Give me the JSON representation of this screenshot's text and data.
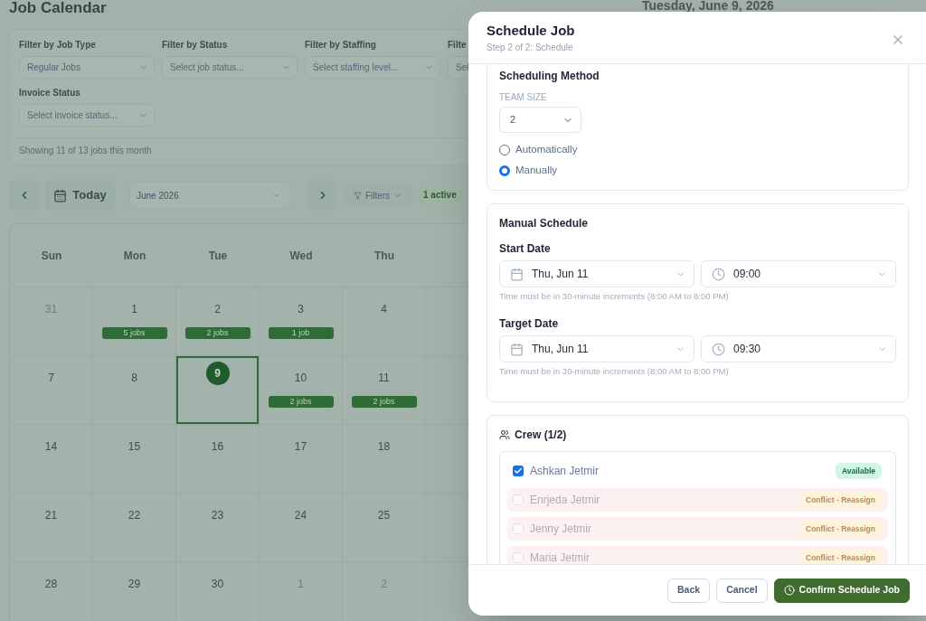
{
  "page": {
    "title": "Job Calendar",
    "date_heading": "Tuesday, June 9, 2026"
  },
  "filters": [
    {
      "label": "Filter by Job Type",
      "value": "Regular Jobs"
    },
    {
      "label": "Filter by Status",
      "placeholder": "Select job status..."
    },
    {
      "label": "Filter by Staffing",
      "placeholder": "Select staffing level..."
    },
    {
      "label": "Filte",
      "placeholder": "Sel"
    },
    {
      "label": "Invoice Status",
      "placeholder": "Select invoice status..."
    }
  ],
  "summary": "Showing 11 of 13 jobs this month",
  "toolbar": {
    "today": "Today",
    "month": "June 2026",
    "filters": "Filters",
    "active_filters": "1 active"
  },
  "calendar": {
    "weekdays": [
      "Sun",
      "Mon",
      "Tue",
      "Wed",
      "Thu"
    ],
    "weeks": [
      [
        {
          "day": "31",
          "outside": true,
          "selected": false
        },
        {
          "day": "1",
          "outside": false,
          "selected": false,
          "jobs": "5 jobs"
        },
        {
          "day": "2",
          "outside": false,
          "selected": false,
          "jobs": "2 jobs"
        },
        {
          "day": "3",
          "outside": false,
          "selected": false,
          "jobs": "1 job"
        },
        {
          "day": "4",
          "outside": false,
          "selected": false
        }
      ],
      [
        {
          "day": "7",
          "outside": false,
          "selected": false
        },
        {
          "day": "8",
          "outside": false,
          "selected": false
        },
        {
          "day": "9",
          "outside": false,
          "selected": true
        },
        {
          "day": "10",
          "outside": false,
          "selected": false,
          "jobs": "2 jobs"
        },
        {
          "day": "11",
          "outside": false,
          "selected": false,
          "jobs": "2 jobs"
        }
      ],
      [
        {
          "day": "14",
          "outside": false,
          "selected": false
        },
        {
          "day": "15",
          "outside": false,
          "selected": false
        },
        {
          "day": "16",
          "outside": false,
          "selected": false
        },
        {
          "day": "17",
          "outside": false,
          "selected": false
        },
        {
          "day": "18",
          "outside": false,
          "selected": false
        }
      ],
      [
        {
          "day": "21",
          "outside": false,
          "selected": false
        },
        {
          "day": "22",
          "outside": false,
          "selected": false
        },
        {
          "day": "23",
          "outside": false,
          "selected": false
        },
        {
          "day": "24",
          "outside": false,
          "selected": false
        },
        {
          "day": "25",
          "outside": false,
          "selected": false
        }
      ],
      [
        {
          "day": "28",
          "outside": false,
          "selected": false
        },
        {
          "day": "29",
          "outside": false,
          "selected": false
        },
        {
          "day": "30",
          "outside": false,
          "selected": false
        },
        {
          "day": "1",
          "outside": true,
          "selected": false
        },
        {
          "day": "2",
          "outside": true,
          "selected": false
        }
      ]
    ]
  },
  "modal": {
    "title": "Schedule Job",
    "subtitle": "Step 2 of 2: Schedule",
    "scheduling": {
      "heading": "Scheduling Method",
      "team_size_label": "TEAM SIZE",
      "team_size": "2",
      "methods": [
        {
          "label": "Automatically",
          "selected": false
        },
        {
          "label": "Manually",
          "selected": true
        }
      ]
    },
    "manual_schedule": {
      "heading": "Manual Schedule",
      "dates": [
        {
          "label": "Start Date",
          "date": "Thu, Jun 11",
          "time": "09:00",
          "hint": "Time must be in 30-minute increments (8:00 AM to 8:00 PM)"
        },
        {
          "label": "Target Date",
          "date": "Thu, Jun 11",
          "time": "09:30",
          "hint": "Time must be in 30-minute increments (8:00 AM to 8:00 PM)"
        }
      ]
    },
    "crew": {
      "heading": "Crew (1/2)",
      "members": [
        {
          "name": "Ashkan Jetmir",
          "checked": true,
          "disabled": false,
          "kind": "available",
          "status": "Available"
        },
        {
          "name": "Enrjeda Jetmir",
          "checked": false,
          "disabled": true,
          "kind": "conflict",
          "status": "Conflict - Reassign"
        },
        {
          "name": "Jenny Jetmir",
          "checked": false,
          "disabled": true,
          "kind": "conflict",
          "status": "Conflict - Reassign"
        },
        {
          "name": "Maria Jetmir",
          "checked": false,
          "disabled": true,
          "kind": "conflict",
          "status": "Conflict - Reassign"
        }
      ]
    },
    "buttons": [
      {
        "label": "Back",
        "kind": "secondary"
      },
      {
        "label": "Cancel",
        "kind": "secondary"
      },
      {
        "label": "Confirm Schedule Job",
        "kind": "primary"
      }
    ]
  }
}
